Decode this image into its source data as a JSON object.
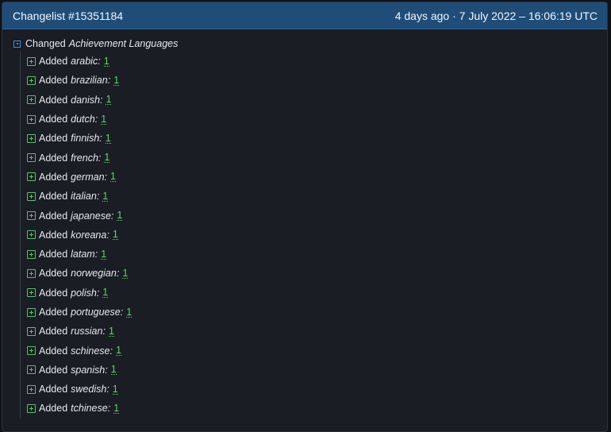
{
  "header": {
    "title": "Changelist #15351184",
    "relative_time": "4 days ago",
    "separator": "·",
    "timestamp": "7 July 2022 – 16:06:19 UTC"
  },
  "root": {
    "verb": "Changed",
    "target": "Achievement Languages"
  },
  "items": [
    {
      "verb": "Added",
      "key": "arabic:",
      "value": "1"
    },
    {
      "verb": "Added",
      "key": "brazilian:",
      "value": "1"
    },
    {
      "verb": "Added",
      "key": "danish:",
      "value": "1"
    },
    {
      "verb": "Added",
      "key": "dutch:",
      "value": "1"
    },
    {
      "verb": "Added",
      "key": "finnish:",
      "value": "1"
    },
    {
      "verb": "Added",
      "key": "french:",
      "value": "1"
    },
    {
      "verb": "Added",
      "key": "german:",
      "value": "1"
    },
    {
      "verb": "Added",
      "key": "italian:",
      "value": "1"
    },
    {
      "verb": "Added",
      "key": "japanese:",
      "value": "1"
    },
    {
      "verb": "Added",
      "key": "koreana:",
      "value": "1"
    },
    {
      "verb": "Added",
      "key": "latam:",
      "value": "1"
    },
    {
      "verb": "Added",
      "key": "norwegian:",
      "value": "1"
    },
    {
      "verb": "Added",
      "key": "polish:",
      "value": "1"
    },
    {
      "verb": "Added",
      "key": "portuguese:",
      "value": "1"
    },
    {
      "verb": "Added",
      "key": "russian:",
      "value": "1"
    },
    {
      "verb": "Added",
      "key": "schinese:",
      "value": "1"
    },
    {
      "verb": "Added",
      "key": "spanish:",
      "value": "1"
    },
    {
      "verb": "Added",
      "key": "swedish:",
      "value": "1"
    },
    {
      "verb": "Added",
      "key": "tchinese:",
      "value": "1"
    }
  ],
  "colors": {
    "header_bg": "#1f4d78",
    "panel_bg": "#1a1d23",
    "added_green": "#55c466",
    "changed_blue": "#3d8fd4"
  },
  "icons": {
    "root": "collapse-box-icon",
    "item": "plus-box-icon"
  }
}
